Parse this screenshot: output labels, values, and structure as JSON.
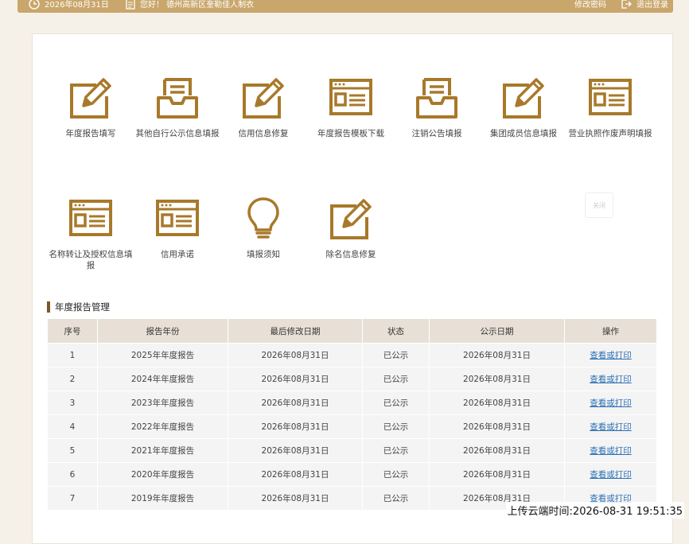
{
  "topbar": {
    "date": "2026年08月31日",
    "greeting": "您好！ 德州高新区奎勒佳人制衣",
    "change_password": "修改密码",
    "logout": "退出登录"
  },
  "tiles": [
    {
      "label": "年度报告填写",
      "icon": "edit-pencil-icon"
    },
    {
      "label": "其他自行公示信息填报",
      "icon": "inbox-tray-icon"
    },
    {
      "label": "信用信息修复",
      "icon": "edit-pencil-icon"
    },
    {
      "label": "年度报告模板下载",
      "icon": "id-card-icon"
    },
    {
      "label": "注销公告填报",
      "icon": "inbox-tray-icon"
    },
    {
      "label": "集团成员信息填报",
      "icon": "edit-pencil-icon"
    },
    {
      "label": "营业执照作废声明填报",
      "icon": "id-card-icon"
    },
    {
      "label": "名称转让及授权信息填报",
      "icon": "id-card-icon"
    },
    {
      "label": "信用承诺",
      "icon": "id-card-icon"
    },
    {
      "label": "填报须知",
      "icon": "lightbulb-icon"
    },
    {
      "label": "除名信息修复",
      "icon": "edit-pencil-icon"
    }
  ],
  "close_label": "关闭",
  "section_title": "年度报告管理",
  "table": {
    "headers": [
      "序号",
      "报告年份",
      "最后修改日期",
      "状态",
      "公示日期",
      "操作"
    ],
    "rows": [
      [
        "1",
        "2025年年度报告",
        "2026年08月31日",
        "已公示",
        "2026年08月31日",
        "查看或打印"
      ],
      [
        "2",
        "2024年年度报告",
        "2026年08月31日",
        "已公示",
        "2026年08月31日",
        "查看或打印"
      ],
      [
        "3",
        "2023年年度报告",
        "2026年08月31日",
        "已公示",
        "2026年08月31日",
        "查看或打印"
      ],
      [
        "4",
        "2022年年度报告",
        "2026年08月31日",
        "已公示",
        "2026年08月31日",
        "查看或打印"
      ],
      [
        "5",
        "2021年年度报告",
        "2026年08月31日",
        "已公示",
        "2026年08月31日",
        "查看或打印"
      ],
      [
        "6",
        "2020年年度报告",
        "2026年08月31日",
        "已公示",
        "2026年08月31日",
        "查看或打印"
      ],
      [
        "7",
        "2019年年度报告",
        "2026年08月31日",
        "已公示",
        "2026年08月31日",
        "查看或打印"
      ]
    ]
  },
  "upload_time": "上传云端时间:2026-08-31 19:51:35",
  "colors": {
    "accent": "#a8792a",
    "topbar": "#c9a66b",
    "link": "#2b6fb5"
  }
}
